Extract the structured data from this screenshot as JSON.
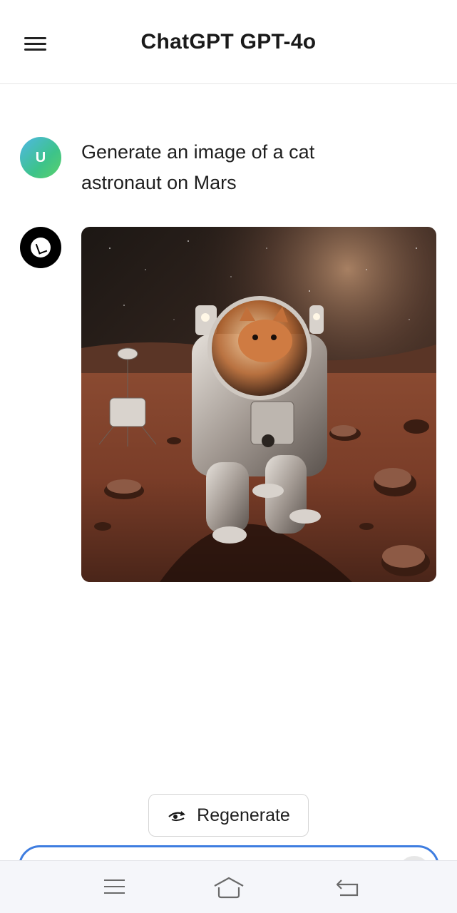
{
  "header": {
    "title": "ChatGPT GPT-4o",
    "menu_icon": "hamburger-menu-icon"
  },
  "messages": [
    {
      "role": "user",
      "avatar_letter": "U",
      "text": "Generate an image of a cat astronaut on Mars"
    },
    {
      "role": "assistant",
      "avatar_icon": "openai-logo-icon",
      "image_description_icon": "generated-image"
    }
  ],
  "actions": {
    "regenerate_label": "Regenerate",
    "regenerate_icon": "regenerate-icon"
  },
  "composer": {
    "send_icon": "send-icon"
  },
  "system_nav": {
    "recents_icon": "recents-icon",
    "home_icon": "home-icon",
    "back_icon": "back-icon"
  },
  "colors": {
    "accent": "#3e7de0",
    "user_avatar_gradient": [
      "#4fb7e6",
      "#5bd16b"
    ],
    "bot_avatar": "#000000"
  }
}
